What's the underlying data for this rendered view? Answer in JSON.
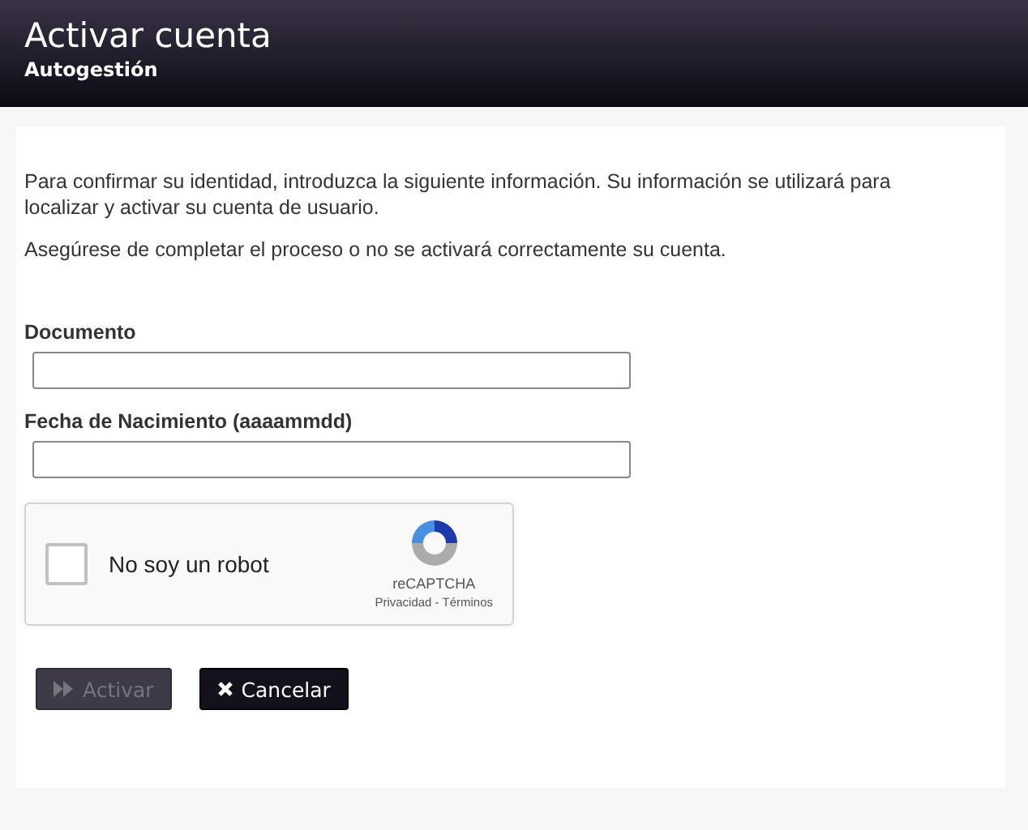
{
  "header": {
    "title": "Activar cuenta",
    "subtitle": "Autogestión"
  },
  "intro": [
    "Para confirmar su identidad, introduzca la siguiente información. Su información se utilizará para localizar y activar su cuenta de usuario.",
    "Asegúrese de completar el proceso o no se activará correctamente su cuenta."
  ],
  "fields": [
    {
      "label": "Documento"
    },
    {
      "label": "Fecha de Nacimiento (aaaammdd)"
    }
  ],
  "captcha": {
    "label": "No soy un robot",
    "checked": false,
    "brand": "reCAPTCHA",
    "links": [
      "Privacidad",
      "Términos"
    ],
    "separator": "-"
  },
  "buttons": [
    {
      "label": "Activar",
      "kind": "activate",
      "disabled": true
    },
    {
      "label": "Cancelar",
      "kind": "cancel",
      "disabled": false
    }
  ]
}
